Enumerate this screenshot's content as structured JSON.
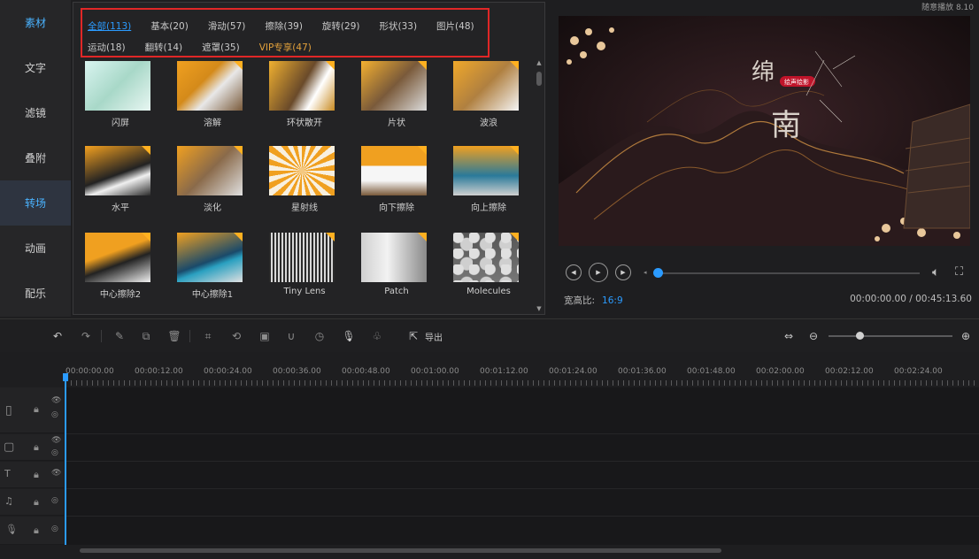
{
  "sidebar": {
    "items": [
      {
        "label": "素材"
      },
      {
        "label": "文字"
      },
      {
        "label": "滤镜"
      },
      {
        "label": "叠附"
      },
      {
        "label": "转场"
      },
      {
        "label": "动画"
      },
      {
        "label": "配乐"
      }
    ]
  },
  "library": {
    "categories_row1": [
      "全部(113)",
      "基本(20)",
      "滑动(57)",
      "擦除(39)",
      "旋转(29)",
      "形状(33)",
      "图片(48)"
    ],
    "categories_row2": [
      "运动(18)",
      "翻转(14)",
      "遮罩(35)",
      "VIP专享(47)"
    ],
    "items": [
      {
        "label": "闪屏",
        "vip": false
      },
      {
        "label": "溶解",
        "vip": true
      },
      {
        "label": "环状散开",
        "vip": true
      },
      {
        "label": "片状",
        "vip": true
      },
      {
        "label": "波浪",
        "vip": true
      },
      {
        "label": "水平",
        "vip": true
      },
      {
        "label": "淡化",
        "vip": true
      },
      {
        "label": "星射线",
        "vip": false
      },
      {
        "label": "向下擦除",
        "vip": true
      },
      {
        "label": "向上擦除",
        "vip": true
      },
      {
        "label": "中心擦除2",
        "vip": true
      },
      {
        "label": "中心擦除1",
        "vip": true
      },
      {
        "label": "Tiny Lens",
        "vip": true
      },
      {
        "label": "Patch",
        "vip": true
      },
      {
        "label": "Molecules",
        "vip": true
      }
    ]
  },
  "preview": {
    "aspect_label": "宽高比:",
    "aspect_value": "16:9",
    "timecode": "00:00:00.00 / 00:45:13.60",
    "top_right": "随意播放 8.10",
    "overlay_badge": "绘声绘影",
    "progress": 0
  },
  "toolbar": {
    "export_label": "导出",
    "zoom_level": 0.25
  },
  "timeline": {
    "ruler": [
      "00:00:00.00",
      "00:00:12.00",
      "00:00:24.00",
      "00:00:36.00",
      "00:00:48.00",
      "00:01:00.00",
      "00:01:12.00",
      "00:01:24.00",
      "00:01:36.00",
      "00:01:48.00",
      "00:02:00.00",
      "00:02:12.00",
      "00:02:24.00"
    ],
    "tracks": [
      "video",
      "overlay",
      "text",
      "music",
      "voice"
    ]
  },
  "colors": {
    "accent": "#2b9bff",
    "vip": "#e2a03b",
    "highlight_box": "#e02727",
    "badge": "#ffb020"
  }
}
